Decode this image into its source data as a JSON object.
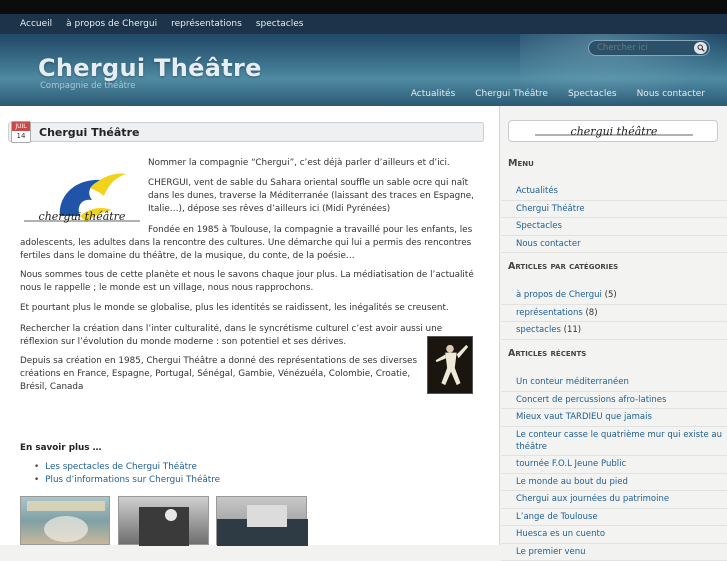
{
  "topnav": [
    "Accueil",
    "à propos de Chergui",
    "représentations",
    "spectacles"
  ],
  "header": {
    "title": "Chergui Théâtre",
    "tagline": "Compagnie de théâtre",
    "search_placeholder": "Chercher ici",
    "nav": [
      "Actualités",
      "Chergui Théâtre",
      "Spectacles",
      "Nous contacter"
    ]
  },
  "post": {
    "date_month": "JUIL",
    "date_day": "14",
    "title": "Chergui Théâtre",
    "logo_text": "chergui théâtre",
    "paragraphs": [
      "Nommer la compagnie “Chergui”, c’est déjà parler d’ailleurs et d’ici.",
      "CHERGUI, vent de sable du Sahara oriental souffle un sable ocre qui naît dans les dunes, traverse la Méditerranée (laissant des traces en Espagne, Italie…), dépose ses rêves d’ailleurs ici (Midi Pyrénées)",
      "Fondée en 1985 à Toulouse, la compagnie a travaillé pour les enfants, les adolescents, les adultes dans la rencontre des cultures. Une démarche qui lui a permis des rencontres fertiles dans le domaine du théâtre, de la musique, du conte, de la poésie…",
      "Nous sommes tous de cette planète et nous le savons chaque jour plus. La médiatisation de l’actualité nous le rappelle ; le monde est un village, nous nous rapprochons.",
      "Et pourtant plus le monde se globalise, plus les identités se raidissent, les inégalités se creusent.",
      "Rechercher la création dans l’inter culturalité, dans le syncrétisme culturel c’est avoir aussi une réflexion sur l’évolution du monde moderne : son potentiel et ses dérives.",
      "Depuis sa création en 1985, Chergui Théâtre a donné des représentations de ses diverses créations en France, Espagne, Portugal, Sénégal, Gambie, Vénézuéla, Colombie, Croatie, Brésil, Canada"
    ],
    "savoir_label": "En savoir plus …",
    "links": [
      "Les spectacles de Chergui Théâtre",
      "Plus d’informations sur Chergui Théâtre"
    ]
  },
  "sidebar": {
    "logo_text": "chergui théâtre",
    "menu_title": "Menu",
    "menu": [
      "Actualités",
      "Chergui Théâtre",
      "Spectacles",
      "Nous contacter"
    ],
    "cat_title": "Articles par catégories",
    "categories": [
      {
        "name": "à propos de Chergui",
        "count": "(5)"
      },
      {
        "name": "représentations",
        "count": "(8)"
      },
      {
        "name": "spectacles",
        "count": "(11)"
      }
    ],
    "recent_title": "Articles récents",
    "recent": [
      "Un conteur méditerranéen",
      "Concert de percussions afro-latines",
      "Mieux vaut TARDIEU que jamais",
      "Le conteur casse le quatrième mur qui existe au théâtre",
      "tournée F.O.L Jeune Public",
      "Le monde au bout du pied",
      "Chergui aux journées du patrimoine",
      "L’ange de Toulouse",
      "Huesca es un cuento",
      "Le premier venu"
    ]
  },
  "colors": {
    "header_dark": "#1c3349",
    "link": "#1d5f95",
    "accent_logo": "#1f54a8",
    "accent_yellow": "#f2d21b"
  }
}
